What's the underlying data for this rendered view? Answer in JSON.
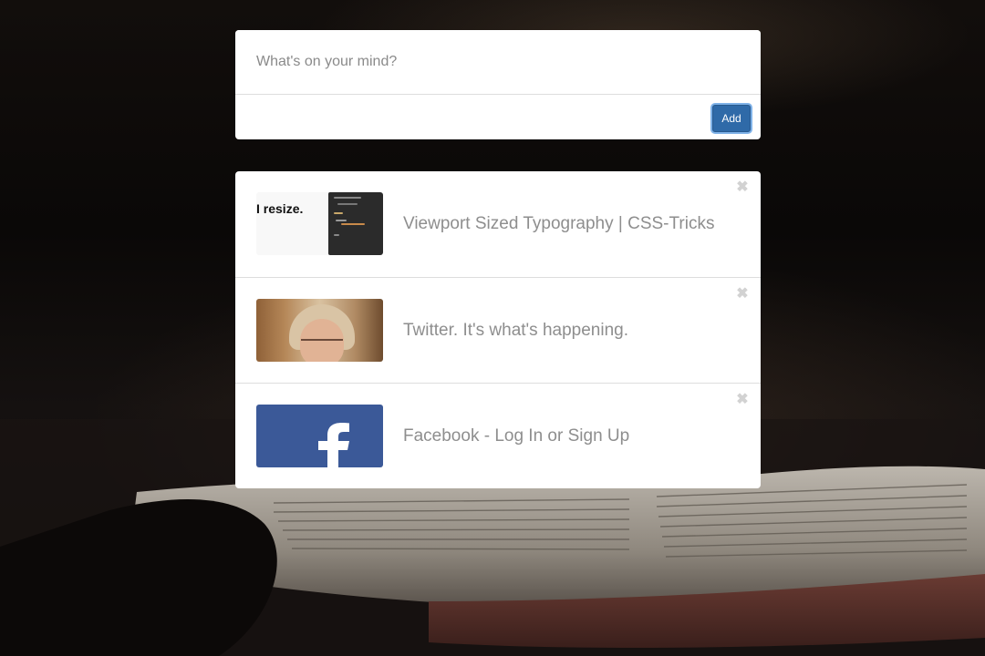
{
  "composer": {
    "placeholder": "What's on your mind?",
    "add_label": "Add"
  },
  "links": [
    {
      "title": "Viewport Sized Typography | CSS-Tricks",
      "thumbnail": "css-tricks-resize-thumbnail",
      "thumbnail_text": "I resize.",
      "remove_icon": "close-icon"
    },
    {
      "title": "Twitter. It's what's happening.",
      "thumbnail": "portrait-thumbnail",
      "remove_icon": "close-icon"
    },
    {
      "title": "Facebook - Log In or Sign Up",
      "thumbnail": "facebook-logo-thumbnail",
      "remove_icon": "close-icon"
    }
  ],
  "colors": {
    "button": "#2f6aa8",
    "link_text": "#8e8e8e",
    "facebook_blue": "#3b5998"
  }
}
